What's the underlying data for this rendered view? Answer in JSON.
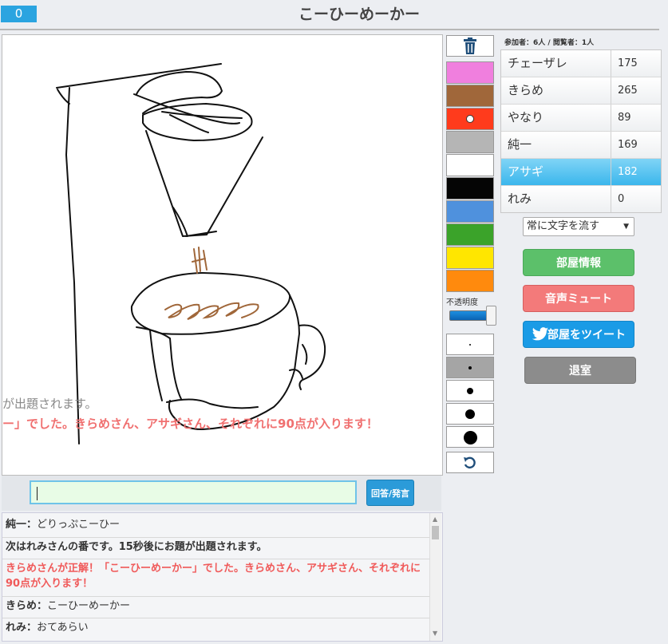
{
  "header": {
    "timer": "0",
    "title": "こーひーめーかー"
  },
  "canvas": {
    "flow_messages": [
      "が出題されます。",
      "ー」でした。きらめさん、アサギさん、それぞれに90点が入ります！"
    ]
  },
  "answer": {
    "input_value": "",
    "button_label": "回答/発言"
  },
  "chat": [
    {
      "name": "純一",
      "text": "どりっぷこーひー",
      "style": "normal"
    },
    {
      "text": "次はれみさんの番です。15秒後にお題が出題されます。",
      "style": "bold"
    },
    {
      "text": "きらめさんが正解！「こーひーめーかー」でした。きらめさん、アサギさん、それぞれに90点が入ります！",
      "style": "red"
    },
    {
      "name": "きらめ",
      "text": "こーひーめーかー",
      "style": "normal"
    },
    {
      "name": "れみ",
      "text": "おてあらい",
      "style": "normal"
    }
  ],
  "palette": {
    "colors": [
      "#f07fde",
      "#a0673a",
      "#ff3b1c",
      "#b5b5b5",
      "#ffffff",
      "#050505",
      "#4f91dd",
      "#3ba32a",
      "#ffe600",
      "#ff8a0d"
    ],
    "selected_color_index": 2,
    "opacity_label": "不透明度",
    "opacity_level": 1.0,
    "pen_sizes": [
      "pen-size-1",
      "pen-size-2",
      "pen-size-3",
      "pen-size-4",
      "pen-size-5"
    ]
  },
  "scoreboard": {
    "participants_label": "参加者：6人 / 閲覧者：1人",
    "players": [
      {
        "name": "チェーザレ",
        "score": "175",
        "active": false
      },
      {
        "name": "きらめ",
        "score": "265",
        "active": false
      },
      {
        "name": "やなり",
        "score": "89",
        "active": false
      },
      {
        "name": "純一",
        "score": "169",
        "active": false
      },
      {
        "name": "アサギ",
        "score": "182",
        "active": true
      },
      {
        "name": "れみ",
        "score": "0",
        "active": false
      }
    ]
  },
  "controls": {
    "flow_select": "常に文字を流す",
    "room_info": "部屋情報",
    "mute": "音声ミュート",
    "tweet": "部屋をツイート",
    "leave": "退室"
  },
  "icons": {
    "trash": "trash-icon",
    "undo": "undo-icon",
    "twitter": "twitter-bird-icon",
    "dropdown": "chevron-down-icon"
  }
}
